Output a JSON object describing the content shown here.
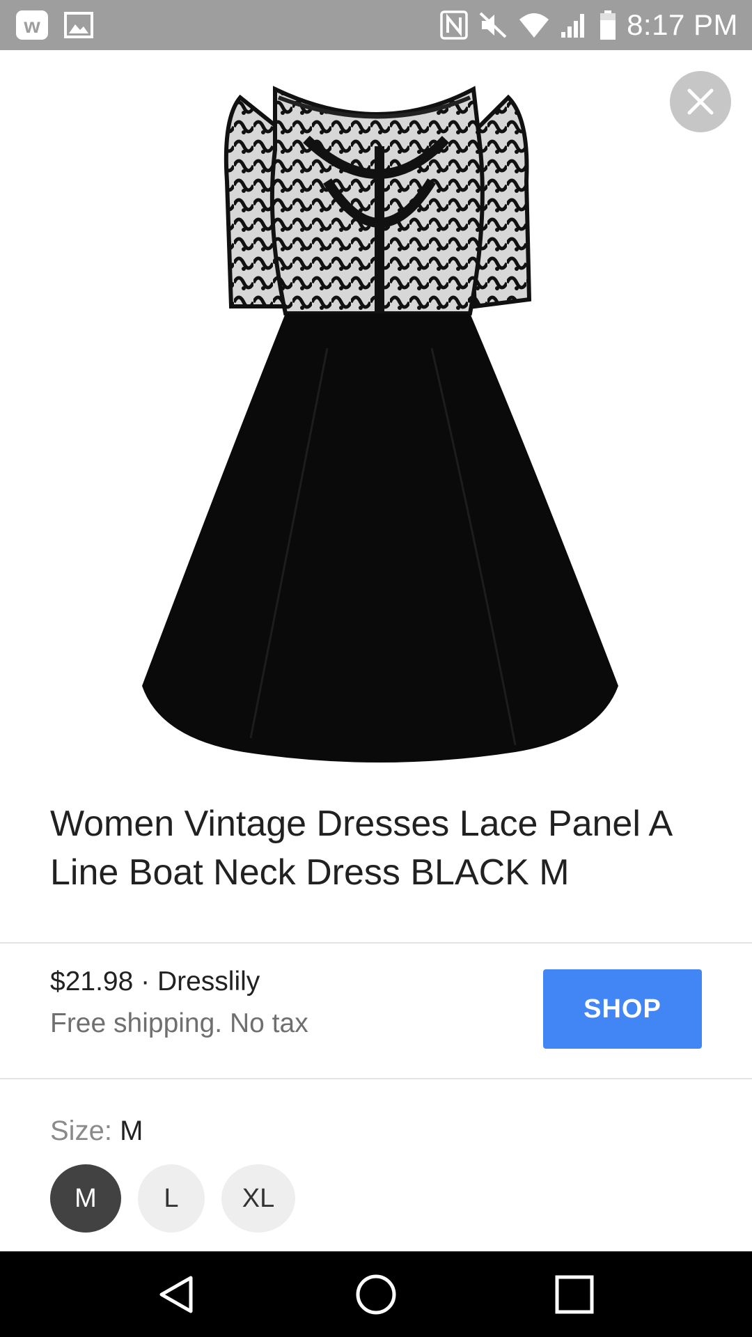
{
  "status_bar": {
    "time": "8:17 PM",
    "left_icons": [
      "w-app-icon",
      "image-notification-icon"
    ],
    "right_icons": [
      "nfc-icon",
      "mute-icon",
      "wifi-icon",
      "signal-icon",
      "battery-icon"
    ]
  },
  "product": {
    "image_alt": "Black lace panel A-line boat neck dress",
    "title": "Women Vintage Dresses Lace Panel A Line Boat Neck Dress BLACK M",
    "price_merchant": "$21.98 · Dresslily",
    "shipping": "Free shipping. No tax",
    "shop_label": "SHOP"
  },
  "size": {
    "label": "Size:",
    "selected": "M",
    "options": [
      "M",
      "L",
      "XL"
    ]
  },
  "colors": {
    "status_bar": "#9e9e9e",
    "shop_button": "#4285f4",
    "selected_chip": "#424242",
    "unselected_chip": "#eeeeee",
    "nav_bar": "#000000"
  },
  "nav_bar": {
    "buttons": [
      "back-icon",
      "home-icon",
      "recents-icon"
    ]
  }
}
